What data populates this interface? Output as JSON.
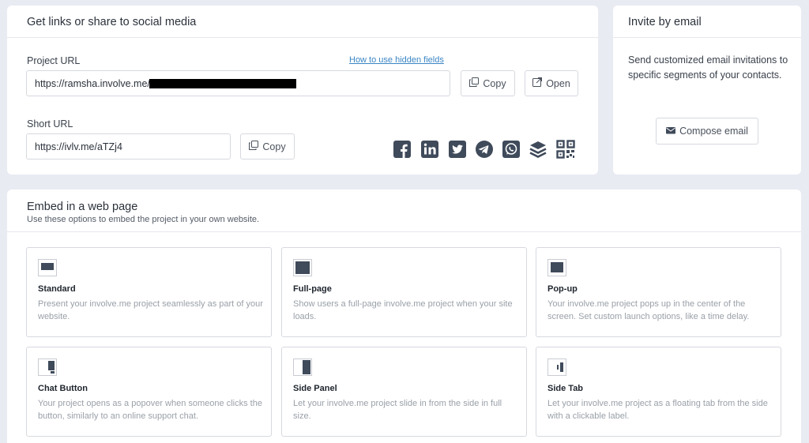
{
  "share": {
    "title": "Get links or share to social media",
    "project_url_label": "Project URL",
    "hidden_fields_link": "How to use hidden fields",
    "project_url_value": "https://ramsha.involve.me/",
    "copy_label": "Copy",
    "open_label": "Open",
    "short_url_label": "Short URL",
    "short_url_value": "https://ivlv.me/aTZj4",
    "short_copy_label": "Copy",
    "social_icons": [
      "facebook-icon",
      "linkedin-icon",
      "twitter-icon",
      "telegram-icon",
      "whatsapp-icon",
      "layers-icon",
      "qr-code-icon"
    ]
  },
  "invite": {
    "title": "Invite by email",
    "text": "Send customized email invitations to specific segments of your contacts.",
    "compose_label": "Compose email"
  },
  "embed": {
    "title": "Embed in a web page",
    "subtitle": "Use these options to embed the project in your own website.",
    "options": [
      {
        "title": "Standard",
        "desc": "Present your involve.me project seamlessly as part of your website."
      },
      {
        "title": "Full-page",
        "desc": "Show users a full-page involve.me project when your site loads."
      },
      {
        "title": "Pop-up",
        "desc": "Your involve.me project pops up in the center of the screen. Set custom launch options, like a time delay."
      },
      {
        "title": "Chat Button",
        "desc": "Your project opens as a popover when someone clicks the button, similarly to an online support chat."
      },
      {
        "title": "Side Panel",
        "desc": "Let your involve.me project slide in from the side in full size."
      },
      {
        "title": "Side Tab",
        "desc": "Let your involve.me project as a floating tab from the side with a clickable label."
      }
    ]
  },
  "colors": {
    "background": "#e9ebf3",
    "icon_dark": "#3f4a5a",
    "link": "#3b86c4"
  }
}
